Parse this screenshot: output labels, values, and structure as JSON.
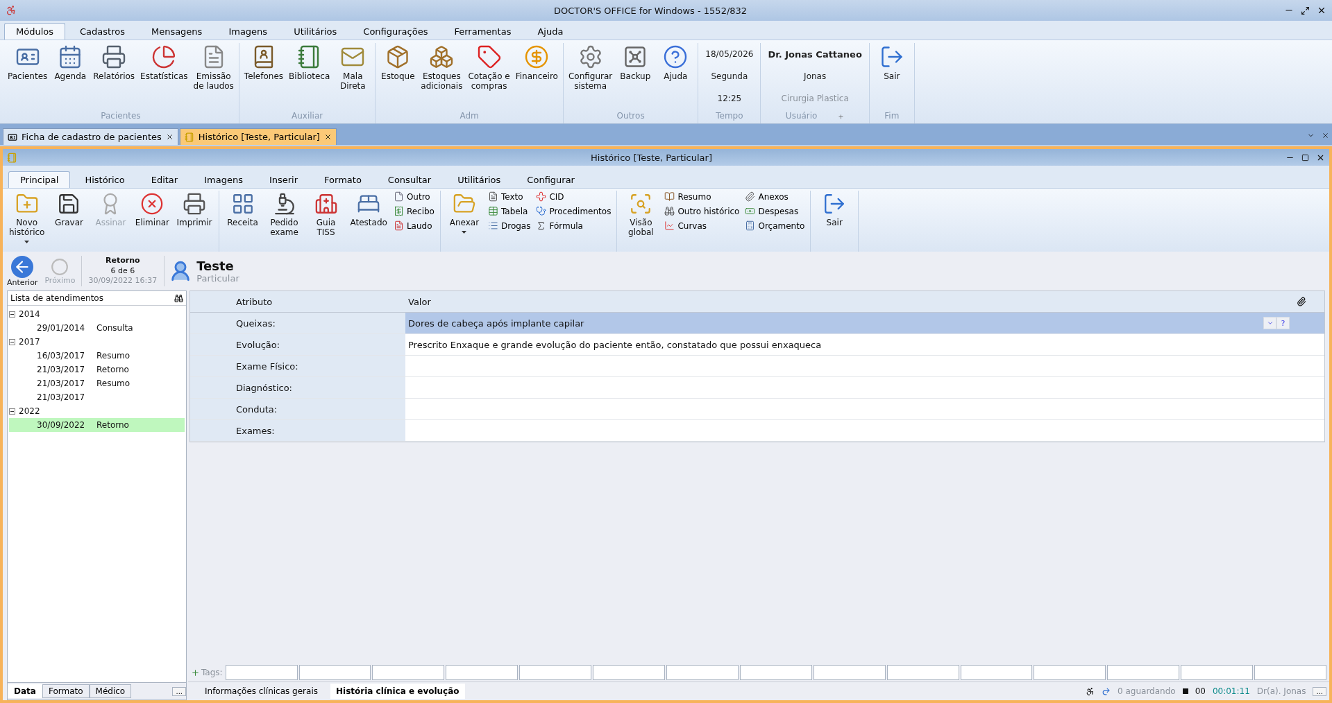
{
  "window": {
    "title": "DOCTOR'S OFFICE for Windows  - 1552/832"
  },
  "menu_tabs": [
    {
      "label": "Módulos",
      "selected": true
    },
    {
      "label": "Cadastros",
      "selected": false
    },
    {
      "label": "Mensagens",
      "selected": false
    },
    {
      "label": "Imagens",
      "selected": false
    },
    {
      "label": "Utilitários",
      "selected": false
    },
    {
      "label": "Configurações",
      "selected": false
    },
    {
      "label": "Ferramentas",
      "selected": false
    },
    {
      "label": "Ajuda",
      "selected": false
    }
  ],
  "ribbon_groups": [
    {
      "kind": "buttons",
      "label": "Pacientes",
      "items": [
        "Pacientes",
        "Agenda",
        "Relatórios",
        "Estatísticas",
        "Emissão\nde laudos"
      ]
    },
    {
      "kind": "buttons",
      "label": "Auxiliar",
      "items": [
        "Telefones",
        "Biblioteca",
        "Mala\nDireta"
      ]
    },
    {
      "kind": "buttons",
      "label": "Adm",
      "items": [
        "Estoque",
        "Estoques\nadicionais",
        "Cotação e\ncompras",
        "Financeiro"
      ]
    },
    {
      "kind": "buttons",
      "label": "Outros",
      "items": [
        "Configurar\nsistema",
        "Backup",
        "Ajuda"
      ]
    },
    {
      "kind": "time",
      "label": "Tempo",
      "lines": [
        "18/05/2026",
        "Segunda",
        "12:25"
      ]
    },
    {
      "kind": "user",
      "label": "Usuário",
      "lines": [
        "Dr. Jonas Cattaneo",
        "Jonas",
        "Cirurgia Plastica"
      ]
    },
    {
      "kind": "buttons",
      "label": "Fim",
      "items": [
        "Sair"
      ]
    }
  ],
  "doc_tabs": [
    {
      "label": "Ficha de cadastro de pacientes",
      "selected": false
    },
    {
      "label": "Histórico [Teste, Particular]",
      "selected": true
    }
  ],
  "child_window": {
    "title": "Histórico [Teste, Particular]"
  },
  "inner_tabs": [
    {
      "label": "Principal",
      "selected": true
    },
    {
      "label": "Histórico",
      "selected": false
    },
    {
      "label": "Editar",
      "selected": false
    },
    {
      "label": "Imagens",
      "selected": false
    },
    {
      "label": "Inserir",
      "selected": false
    },
    {
      "label": "Formato",
      "selected": false
    },
    {
      "label": "Consultar",
      "selected": false
    },
    {
      "label": "Utilitários",
      "selected": false
    },
    {
      "label": "Configurar",
      "selected": false
    }
  ],
  "inner_ribbon": [
    [
      {
        "kind": "large",
        "label": "Novo\nhistórico",
        "disabled": false,
        "dropdown": true
      },
      {
        "kind": "large",
        "label": "Gravar",
        "disabled": false,
        "dropdown": false
      },
      {
        "kind": "large",
        "label": "Assinar",
        "disabled": true,
        "dropdown": false
      },
      {
        "kind": "large",
        "label": "Eliminar",
        "disabled": false,
        "dropdown": false
      },
      {
        "kind": "large",
        "label": "Imprimir",
        "disabled": false,
        "dropdown": false
      }
    ],
    [
      {
        "kind": "large",
        "label": "Receita",
        "disabled": false,
        "dropdown": false
      },
      {
        "kind": "large",
        "label": "Pedido\nexame",
        "disabled": false,
        "dropdown": false
      },
      {
        "kind": "large",
        "label": "Guia\nTISS",
        "disabled": false,
        "dropdown": false
      },
      {
        "kind": "large",
        "label": "Atestado",
        "disabled": false,
        "dropdown": false
      },
      {
        "kind": "stack",
        "items": [
          "Outro",
          "Recibo",
          "Laudo"
        ]
      }
    ],
    [
      {
        "kind": "large",
        "label": "Anexar",
        "disabled": false,
        "dropdown": true
      },
      {
        "kind": "stack",
        "items": [
          "Texto",
          "Tabela",
          "Drogas"
        ]
      },
      {
        "kind": "stack",
        "items": [
          "CID",
          "Procedimentos",
          "Fórmula"
        ]
      }
    ],
    [
      {
        "kind": "large",
        "label": "Visão\nglobal",
        "disabled": false,
        "dropdown": false
      },
      {
        "kind": "stack",
        "items": [
          "Resumo",
          "Outro histórico",
          "Curvas"
        ]
      },
      {
        "kind": "stack",
        "items": [
          "Anexos",
          "Despesas",
          "Orçamento"
        ]
      }
    ],
    [
      {
        "kind": "large",
        "label": "Sair",
        "disabled": false,
        "dropdown": false
      }
    ]
  ],
  "navigation": {
    "previous": {
      "label": "Anterior",
      "disabled": false
    },
    "next": {
      "label": "Próximo",
      "disabled": true
    },
    "record": {
      "type": "Retorno",
      "position": "6 de 6",
      "datetime": "30/09/2022 16:37"
    }
  },
  "patient": {
    "name": "Teste",
    "category": "Particular"
  },
  "visit_list": {
    "title": "Lista de atendimentos",
    "years": [
      {
        "year": "2014",
        "expanded": true,
        "children": [
          {
            "date": "29/01/2014",
            "type": "Consulta",
            "selected": false
          }
        ]
      },
      {
        "year": "2017",
        "expanded": true,
        "children": [
          {
            "date": "16/03/2017",
            "type": "Resumo",
            "selected": false
          },
          {
            "date": "21/03/2017",
            "type": "Retorno",
            "selected": false
          },
          {
            "date": "21/03/2017",
            "type": "Resumo",
            "selected": false
          },
          {
            "date": "21/03/2017",
            "selected": false
          }
        ]
      },
      {
        "year": "2022",
        "expanded": true,
        "children": [
          {
            "date": "30/09/2022",
            "type": "Retorno",
            "selected": true
          }
        ]
      }
    ],
    "tabs": [
      {
        "label": "Data",
        "selected": true
      },
      {
        "label": "Formato",
        "selected": false
      },
      {
        "label": "Médico",
        "selected": false
      }
    ],
    "more": "..."
  },
  "table": {
    "columns": [
      "Atributo",
      "Valor"
    ],
    "rows": [
      {
        "attribute": "Queixas:",
        "value": "Dores de cabeça após implante capilar",
        "selected": true
      },
      {
        "attribute": "Evolução:",
        "value": "Prescrito Enxaque e grande evolução do paciente então, constatado que possui enxaqueca",
        "selected": false
      },
      {
        "attribute": "Exame Físico:",
        "selected": false
      },
      {
        "attribute": "Diagnóstico:",
        "selected": false
      },
      {
        "attribute": "Conduta:",
        "selected": false
      },
      {
        "attribute": "Exames:",
        "selected": false
      }
    ],
    "help": "?"
  },
  "tags": {
    "label": "Tags:"
  },
  "bottom_tabs": [
    {
      "label": "Informações clínicas gerais",
      "selected": false
    },
    {
      "label": "História clínica e evolução",
      "selected": true
    }
  ],
  "status_bar": {
    "waiting": "0 aguardando",
    "counter": "00",
    "timer": "00:01:11",
    "user": "Dr(a). Jonas",
    "more": "..."
  }
}
